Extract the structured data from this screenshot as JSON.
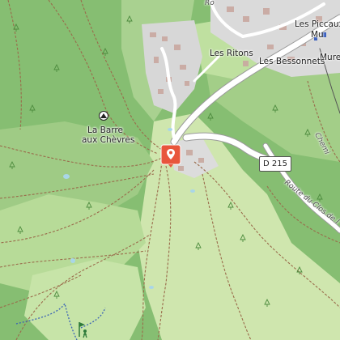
{
  "map": {
    "labels": {
      "les_piccaux": "Les Piccaux",
      "mu_top": "Mu",
      "mure": "Mure",
      "les_ritons": "Les Ritons",
      "les_bessonnets": "Les Bessonnets",
      "la_barre": "La Barre",
      "aux_chevres": "aux Chèvres",
      "route_clos": "Route du Clos de l",
      "chemin": "Chemi",
      "road_ro": "Ro"
    },
    "road_shield": "D 215"
  },
  "colors": {
    "forest": "#8fc27a",
    "meadow": "#d6eab8",
    "urban": "#d9d9d9",
    "marker": "#e8553c",
    "road": "#ffffff",
    "path": "#9a6b4b"
  },
  "icons": {
    "marker": "map-pin-icon",
    "peak": "summit-icon",
    "golf": "golf-icon"
  }
}
